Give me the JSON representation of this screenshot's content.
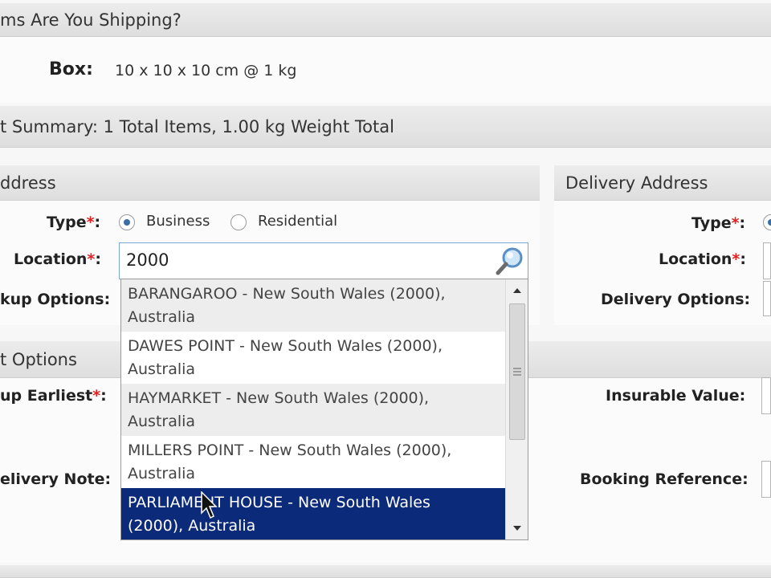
{
  "items_section": {
    "title": "ms Are You Shipping?",
    "box_label": "Box:",
    "box_value": "10 x 10 x 10 cm @ 1 kg"
  },
  "summary": {
    "text": "t Summary: 1 Total Items, 1.00 kg Weight Total"
  },
  "pickup": {
    "title": "ddress",
    "type_label": "Type",
    "required_mark": "*",
    "colon": ":",
    "radio_business": "Business",
    "radio_residential": "Residential",
    "selected_type": "Business",
    "location_label": "Location",
    "location_value": "2000",
    "options_label": "kup Options:"
  },
  "delivery": {
    "title": "Delivery Address",
    "type_label": "Type",
    "location_label": "Location",
    "options_label": "Delivery Options:"
  },
  "options_section": {
    "title": "t Options",
    "earliest_label": "up Earliest",
    "delivery_note_label": "elivery Note:",
    "insurable_label": "Insurable Value:",
    "booking_ref_label": "Booking Reference:"
  },
  "autocomplete": {
    "items": [
      {
        "line1": "BARANGAROO - New South Wales (2000),",
        "line2": "Australia"
      },
      {
        "line1": "DAWES POINT - New South Wales (2000),",
        "line2": "Australia"
      },
      {
        "line1": "HAYMARKET - New South Wales (2000),",
        "line2": "Australia"
      },
      {
        "line1": "MILLERS POINT - New South Wales (2000),",
        "line2": "Australia"
      },
      {
        "line1": "PARLIAMENT HOUSE - New South Wales",
        "line2": "(2000), Australia"
      }
    ],
    "selected_index": 4
  },
  "colors": {
    "selected_bg": "#0b2a7a",
    "required": "#e02020",
    "radio_dot": "#3a6ea5"
  }
}
